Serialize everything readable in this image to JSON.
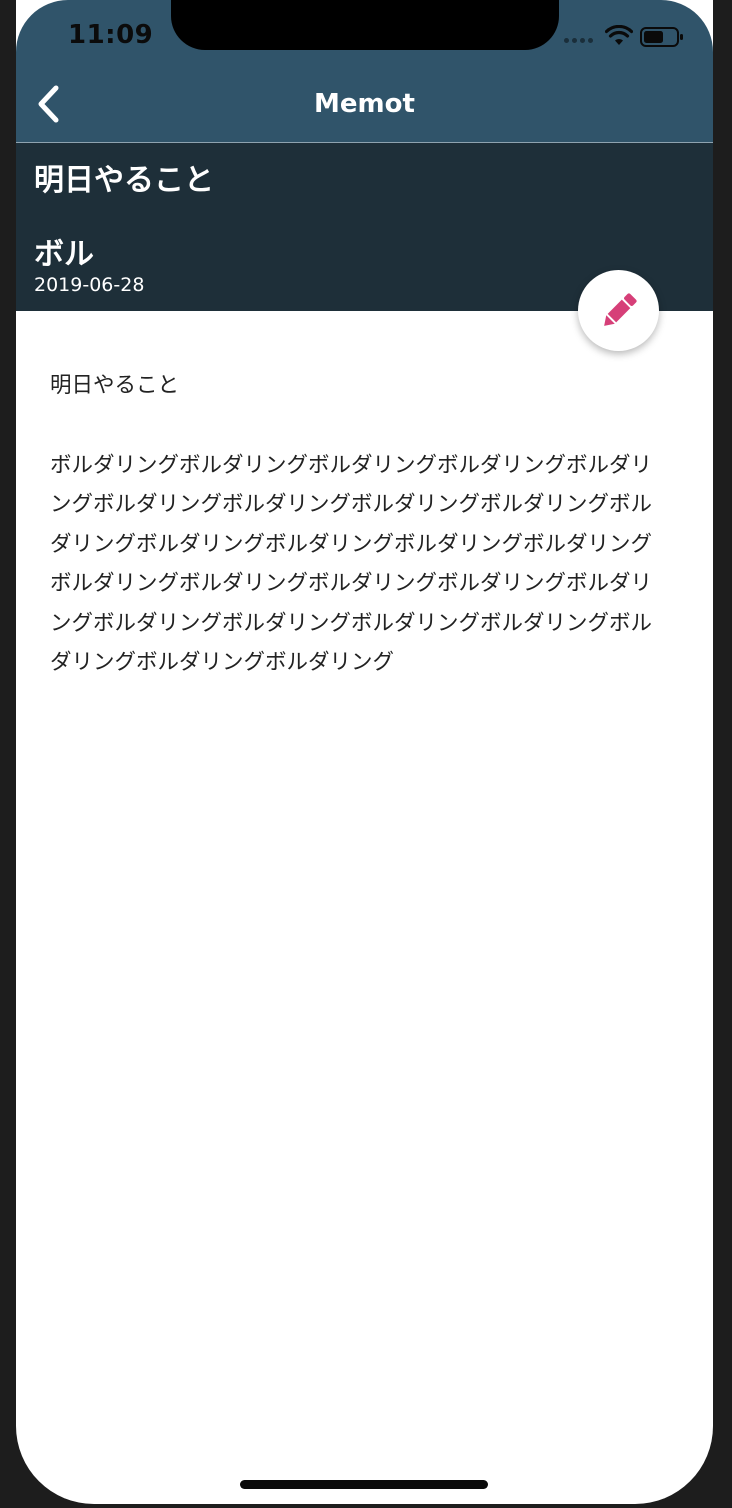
{
  "status_bar": {
    "time": "11:09",
    "icons": [
      "signal-dots-icon",
      "wifi-icon",
      "battery-icon"
    ]
  },
  "app_bar": {
    "title": "Memot",
    "back_icon": "chevron-left-icon",
    "background_color": "#30546a"
  },
  "memo_header": {
    "folder": "明日やること",
    "title": "ボル",
    "date": "2019-06-28",
    "background_color": "#1e2f39"
  },
  "edit_button": {
    "icon": "pencil-icon",
    "icon_color": "#d63f78"
  },
  "memo_content": {
    "heading": "明日やること",
    "body": "ボルダリングボルダリングボルダリングボルダリングボルダリングボルダリングボルダリングボルダリングボルダリングボルダリングボルダリングボルダリングボルダリングボルダリングボルダリングボルダリングボルダリングボルダリングボルダリングボルダリングボルダリングボルダリングボルダリングボルダリングボルダリングボルダリング"
  }
}
